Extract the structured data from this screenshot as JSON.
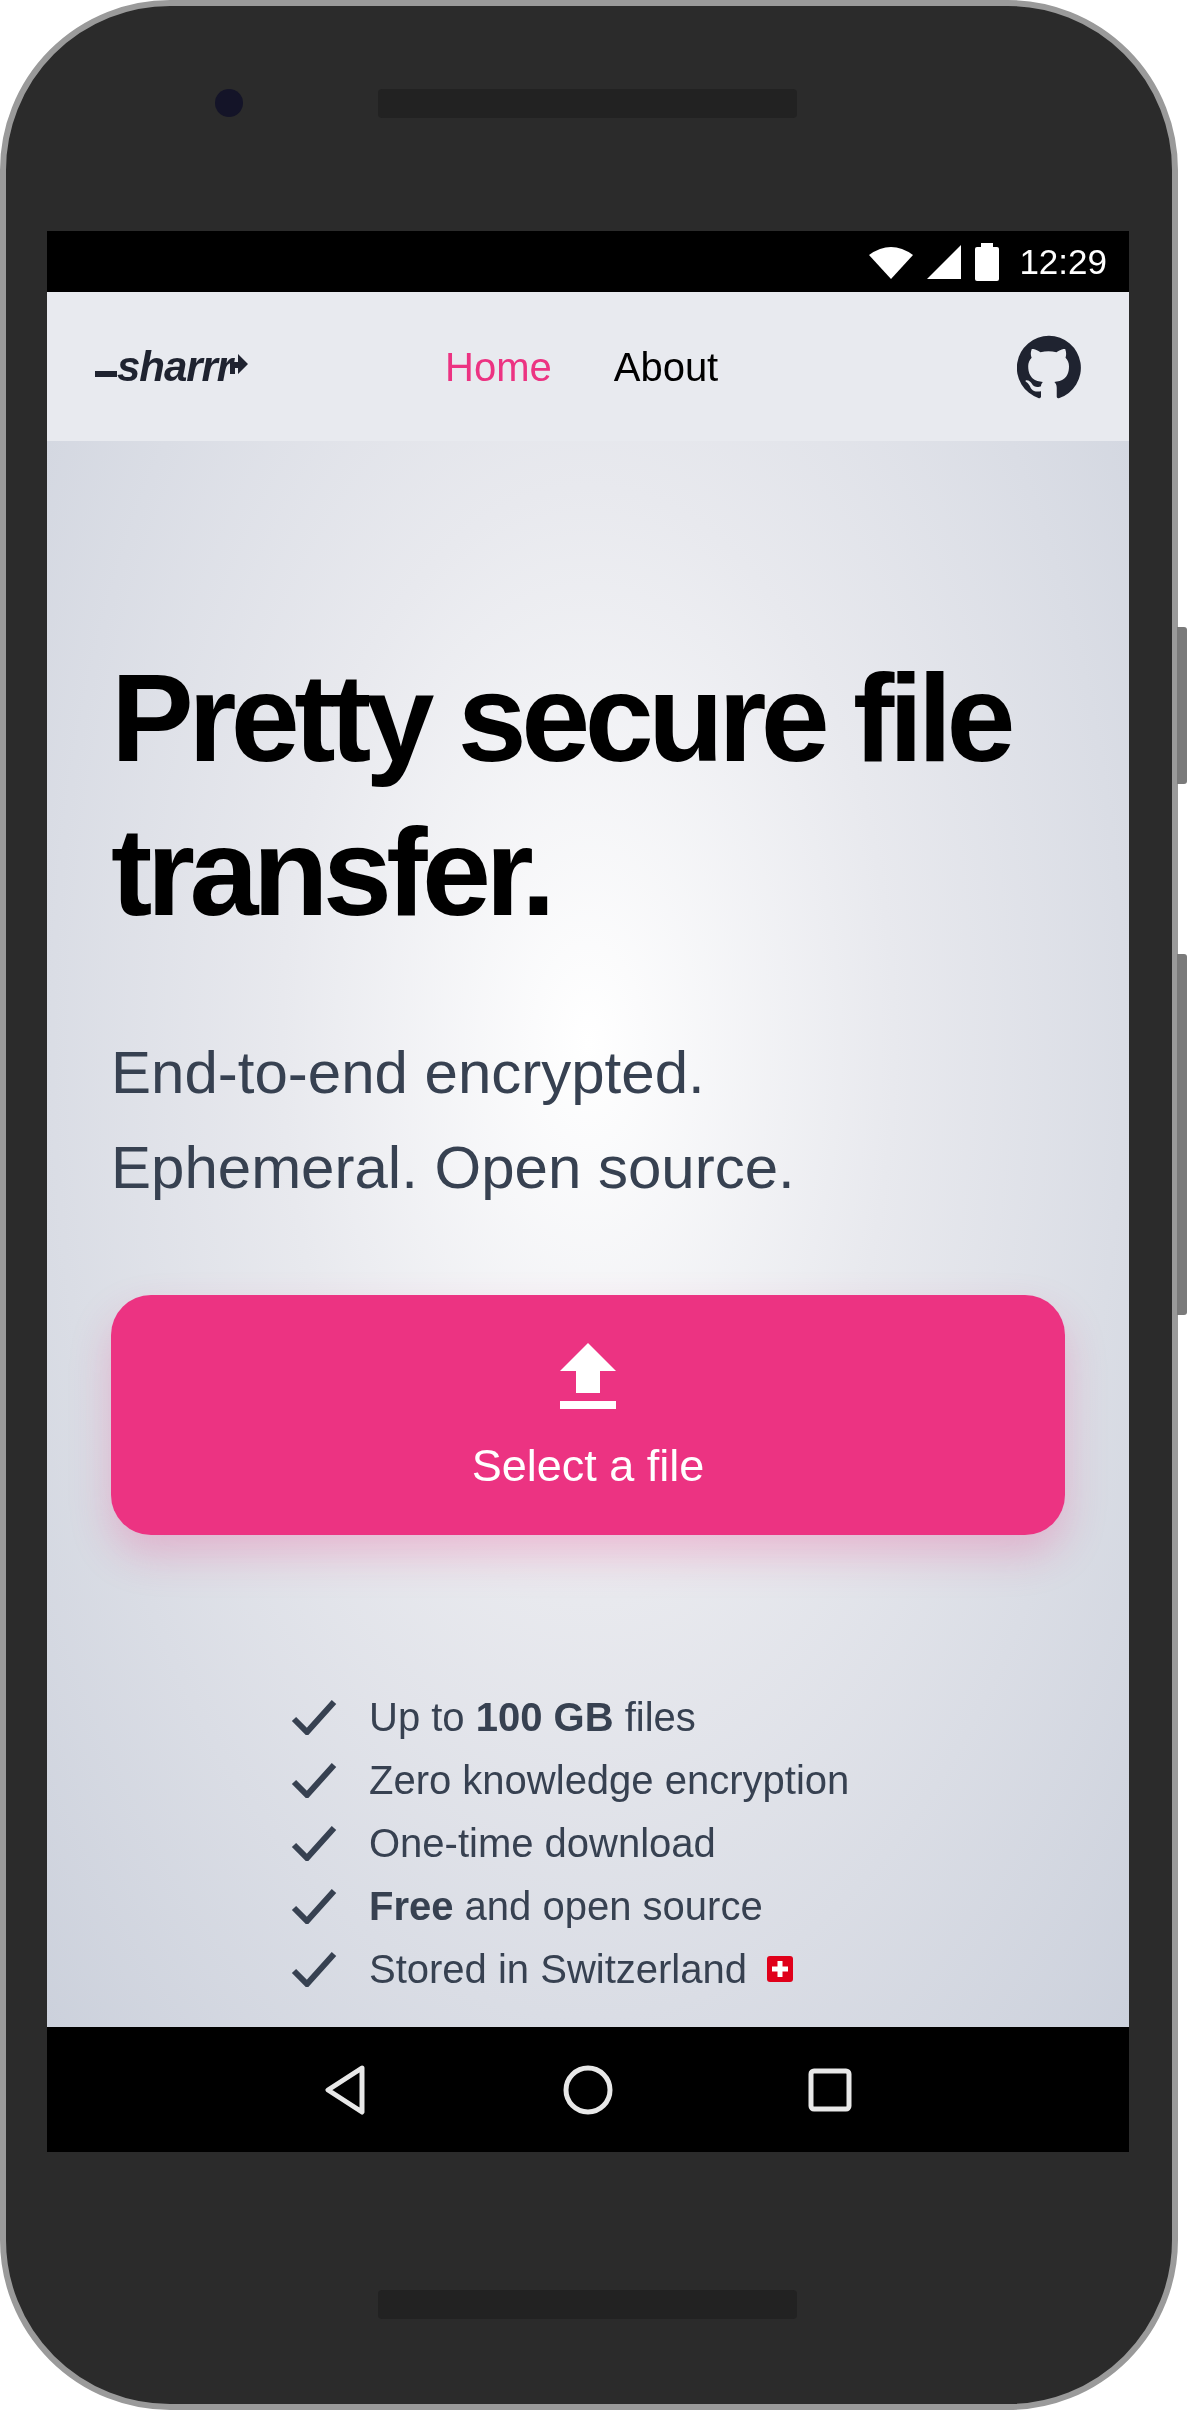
{
  "status_bar": {
    "time": "12:29"
  },
  "header": {
    "logo": "sharrr",
    "nav": [
      {
        "label": "Home",
        "selected": true
      },
      {
        "label": "About",
        "selected": false
      }
    ]
  },
  "hero": {
    "title": "Pretty secure file transfer.",
    "subtitle_lines": [
      "End-to-end encrypted.",
      "Ephemeral. Open source."
    ],
    "upload_button": {
      "label": "Select a file"
    }
  },
  "features": [
    {
      "text": "Up to **100 GB** files",
      "flag": false
    },
    {
      "text": "Zero knowledge encryption",
      "flag": false
    },
    {
      "text": "One-time download",
      "flag": false
    },
    {
      "text": "**Free** and open source",
      "flag": false
    },
    {
      "text": "Stored in Switzerland",
      "flag": true
    }
  ]
}
